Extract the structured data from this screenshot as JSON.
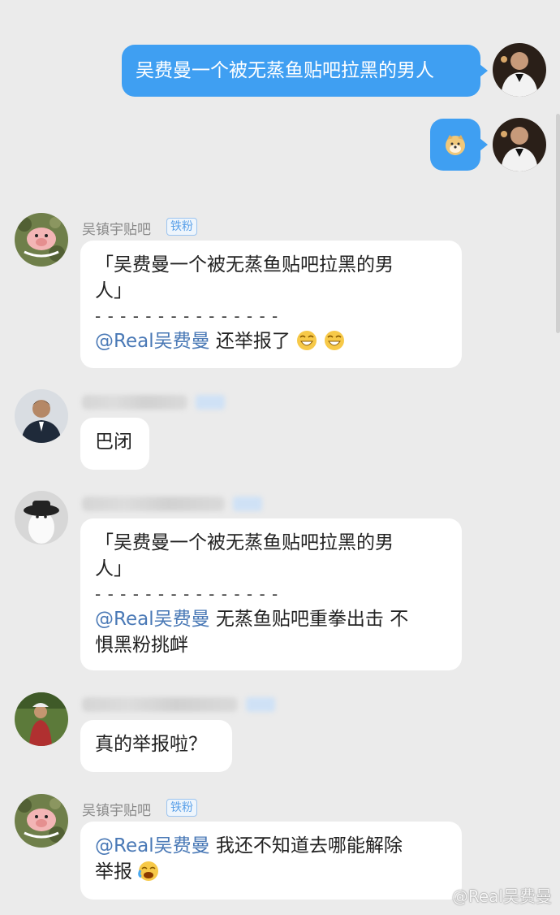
{
  "messages_sent": [
    {
      "text": "吴费曼一个被无蒸鱼贴吧拉黑的男人"
    },
    {
      "sticker": "doge-icon"
    }
  ],
  "msg1": {
    "name": "吴镇宇贴吧",
    "badge": "铁粉",
    "line1": "「吴费曼一个被无蒸鱼贴吧拉黑的男",
    "line2": "人」",
    "divider": "- - - - - - - - - - - - - - -",
    "mention": "@Real吴费曼",
    "tail": " 还举报了"
  },
  "msg2": {
    "text": "巴闭"
  },
  "msg3": {
    "line1": "「吴费曼一个被无蒸鱼贴吧拉黑的男",
    "line2": "人」",
    "divider": "- - - - - - - - - - - - - - -",
    "mention": "@Real吴费曼",
    "tail": " 无蒸鱼贴吧重拳出击 不",
    "line4": "惧黑粉挑衅"
  },
  "msg4": {
    "text": "真的举报啦？"
  },
  "msg5": {
    "name": "吴镇宇贴吧",
    "badge": "铁粉",
    "mention": "@Real吴费曼",
    "tail": " 我还不知道去哪能解除",
    "line2": "举报"
  },
  "watermark": "@Real吴费曼",
  "colors": {
    "sent_bubble": "#3f9ff2",
    "mention": "#4a79b6",
    "background": "#ebebeb"
  }
}
